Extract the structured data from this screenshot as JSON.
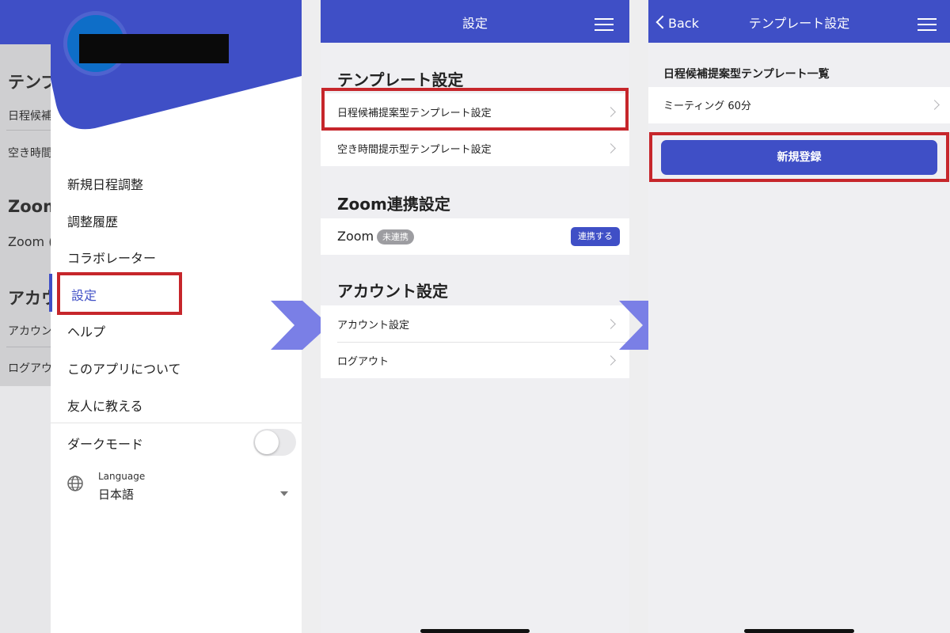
{
  "screen1": {
    "background": {
      "sections": [
        {
          "title": "テンプ",
          "items": [
            "日程候補",
            "空き時間"
          ]
        },
        {
          "title": "Zoom",
          "items": [
            "Zoom ("
          ]
        },
        {
          "title": "アカウ",
          "items": [
            "アカウン",
            "ログアウ"
          ]
        }
      ]
    },
    "drawer": {
      "menu": [
        "新規日程調整",
        "調整履歴",
        "コラボレーター",
        "設定",
        "ヘルプ",
        "このアプリについて",
        "友人に教える"
      ],
      "active_index": 3,
      "dark_mode_label": "ダークモード",
      "dark_mode_on": false,
      "language_label": "Language",
      "language_value": "日本語"
    }
  },
  "screen2": {
    "nav_title": "設定",
    "sections": {
      "template": {
        "title": "テンプレート設定",
        "items": [
          "日程候補提案型テンプレート設定",
          "空き時間提示型テンプレート設定"
        ]
      },
      "zoom": {
        "title": "Zoom連携設定",
        "label": "Zoom",
        "status_badge": "未連携",
        "connect_button": "連携する"
      },
      "account": {
        "title": "アカウント設定",
        "items": [
          "アカウント設定",
          "ログアウト"
        ]
      }
    }
  },
  "screen3": {
    "back_label": "Back",
    "nav_title": "テンプレート設定",
    "list_title": "日程候補提案型テンプレート一覧",
    "items": [
      "ミーティング 60分"
    ],
    "new_button": "新規登録"
  },
  "colors": {
    "brand": "#3f4fc6",
    "highlight": "#c6262b",
    "arrow": "#7a7fe6"
  },
  "icons": [
    "hamburger-icon",
    "chevron-right-icon",
    "chevron-left-icon",
    "globe-icon",
    "step-arrow-icon"
  ]
}
